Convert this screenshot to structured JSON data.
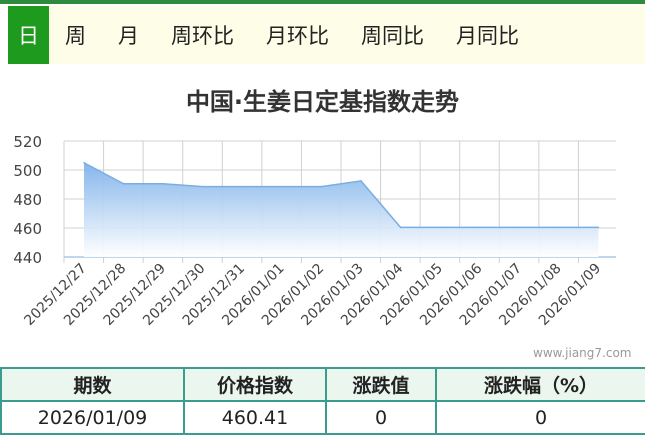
{
  "tabs": [
    "日",
    "周",
    "月",
    "周环比",
    "月环比",
    "周同比",
    "月同比"
  ],
  "active_tab": 0,
  "watermark": "www.jiang7.com",
  "table": {
    "headers": [
      "期数",
      "价格指数",
      "涨跌值",
      "涨跌幅（%）"
    ],
    "row": [
      "2026/01/09",
      "460.41",
      "0",
      "0"
    ]
  },
  "chart_data": {
    "type": "area",
    "title": "中国·生姜日定基指数走势",
    "categories": [
      "2025/12/27",
      "2025/12/28",
      "2025/12/29",
      "2025/12/30",
      "2025/12/31",
      "2026/01/01",
      "2026/01/02",
      "2026/01/03",
      "2026/01/04",
      "2026/01/05",
      "2026/01/06",
      "2026/01/07",
      "2026/01/08",
      "2026/01/09"
    ],
    "series": [
      {
        "values": [
          505,
          490.5,
          490.5,
          488.5,
          488.5,
          488.5,
          488.5,
          492.5,
          460.41,
          460.41,
          460.41,
          460.41,
          460.41,
          460.41
        ]
      }
    ],
    "ylim": [
      440,
      520
    ],
    "yticks": [
      440,
      460,
      480,
      500,
      520
    ],
    "grid": true,
    "colors": {
      "line": "#7aaee0",
      "fill_top": "#7fb2ea",
      "fill_bottom": "#ffffff",
      "grid": "#d0d0d0",
      "axis": "#a9c8e8"
    }
  }
}
